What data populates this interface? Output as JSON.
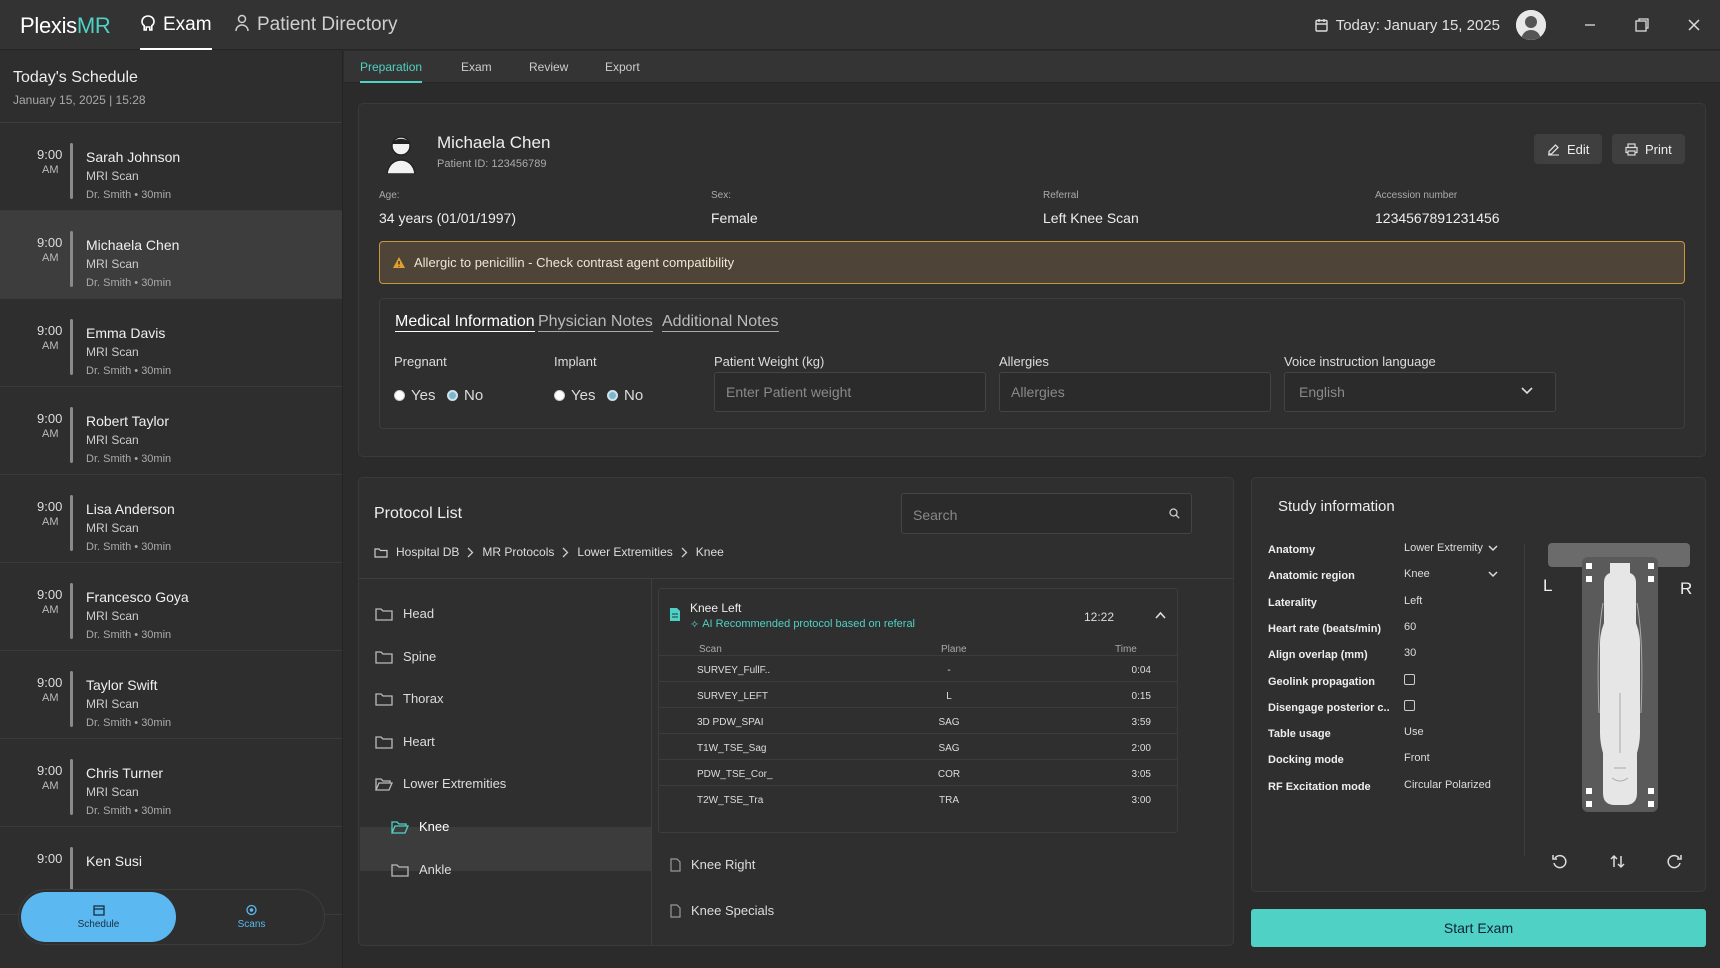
{
  "app": {
    "logo_a": "Plexis",
    "logo_b": "MR",
    "nav": [
      {
        "label": "Exam"
      },
      {
        "label": "Patient Directory"
      }
    ],
    "date": "Today: January 15, 2025"
  },
  "schedule": {
    "title": "Today's Schedule",
    "date": "January 15, 2025 | 15:28",
    "items": [
      {
        "time": "9:00",
        "ampm": "AM",
        "name": "Sarah Johnson",
        "type": "MRI Scan",
        "doctor": "Dr. Smith • 30min"
      },
      {
        "time": "9:00",
        "ampm": "AM",
        "name": "Michaela Chen",
        "type": "MRI Scan",
        "doctor": "Dr. Smith • 30min"
      },
      {
        "time": "9:00",
        "ampm": "AM",
        "name": "Emma Davis",
        "type": "MRI Scan",
        "doctor": "Dr. Smith • 30min"
      },
      {
        "time": "9:00",
        "ampm": "AM",
        "name": "Robert Taylor",
        "type": "MRI Scan",
        "doctor": "Dr. Smith • 30min"
      },
      {
        "time": "9:00",
        "ampm": "AM",
        "name": "Lisa Anderson",
        "type": "MRI Scan",
        "doctor": "Dr. Smith • 30min"
      },
      {
        "time": "9:00",
        "ampm": "AM",
        "name": "Francesco Goya",
        "type": "MRI Scan",
        "doctor": "Dr. Smith • 30min"
      },
      {
        "time": "9:00",
        "ampm": "AM",
        "name": "Taylor Swift",
        "type": "MRI Scan",
        "doctor": "Dr. Smith • 30min"
      },
      {
        "time": "9:00",
        "ampm": "AM",
        "name": "Chris Turner",
        "type": "MRI Scan",
        "doctor": "Dr. Smith • 30min"
      },
      {
        "time": "9:00",
        "ampm": "",
        "name": "Ken Susi",
        "type": "",
        "doctor": ""
      }
    ],
    "bottom_nav": {
      "schedule": "Schedule",
      "scans": "Scans"
    }
  },
  "subtabs": [
    "Preparation",
    "Exam",
    "Review",
    "Export"
  ],
  "patient": {
    "name": "Michaela Chen",
    "id": "Patient ID: 123456789",
    "edit": "Edit",
    "print": "Print",
    "fields": [
      {
        "label": "Age:",
        "value": "34 years (01/01/1997)"
      },
      {
        "label": "Sex:",
        "value": "Female"
      },
      {
        "label": "Referral",
        "value": "Left Knee Scan"
      },
      {
        "label": "Accession number",
        "value": "1234567891231456"
      }
    ],
    "alert": "Allergic to penicillin - Check contrast agent compatibility"
  },
  "medical": {
    "tabs": [
      "Medical Information",
      "Physician Notes",
      "Additional Notes"
    ],
    "pregnant": {
      "label": "Pregnant",
      "yes": "Yes",
      "no": "No"
    },
    "implant": {
      "label": "Implant",
      "yes": "Yes",
      "no": "No"
    },
    "weight": {
      "label": "Patient Weight (kg)",
      "placeholder": "Enter Patient weight"
    },
    "allergies": {
      "label": "Allergies",
      "placeholder": "Allergies"
    },
    "language": {
      "label": "Voice instruction language",
      "value": "English"
    }
  },
  "protocol": {
    "title": "Protocol List",
    "search_placeholder": "Search",
    "breadcrumb": [
      "Hospital DB",
      "MR Protocols",
      "Lower Extremities",
      "Knee"
    ],
    "folders": [
      "Head",
      "Spine",
      "Thorax",
      "Heart",
      "Lower Extremities",
      "Knee",
      "Ankle"
    ],
    "selected": {
      "name": "Knee Left",
      "ai": "AI Recommended protocol based on referal",
      "time": "12:22",
      "headers": {
        "scan": "Scan",
        "plane": "Plane",
        "time": "Time"
      },
      "rows": [
        {
          "scan": "SURVEY_FullF..",
          "plane": "-",
          "time": "0:04"
        },
        {
          "scan": "SURVEY_LEFT",
          "plane": "L",
          "time": "0:15"
        },
        {
          "scan": "3D PDW_SPAI",
          "plane": "SAG",
          "time": "3:59"
        },
        {
          "scan": "T1W_TSE_Sag",
          "plane": "SAG",
          "time": "2:00"
        },
        {
          "scan": "PDW_TSE_Cor_",
          "plane": "COR",
          "time": "3:05"
        },
        {
          "scan": "T2W_TSE_Tra",
          "plane": "TRA",
          "time": "3:00"
        }
      ]
    },
    "others": [
      "Knee Right",
      "Knee Specials"
    ]
  },
  "study": {
    "title": "Study information",
    "rows": [
      {
        "label": "Anatomy",
        "value": "Lower Extremity",
        "kind": "select"
      },
      {
        "label": "Anatomic region",
        "value": "Knee",
        "kind": "select"
      },
      {
        "label": "Laterality",
        "value": "Left",
        "kind": "text"
      },
      {
        "label": "Heart rate (beats/min)",
        "value": "60",
        "kind": "text"
      },
      {
        "label": "Align overlap (mm)",
        "value": "30",
        "kind": "text"
      },
      {
        "label": "Geolink propagation",
        "value": "",
        "kind": "check"
      },
      {
        "label": "Disengage posterior c..",
        "value": "",
        "kind": "check"
      },
      {
        "label": "Table usage",
        "value": "Use",
        "kind": "text"
      },
      {
        "label": "Docking mode",
        "value": "Front",
        "kind": "text"
      },
      {
        "label": "RF Excitation mode",
        "value": "Circular Polarized",
        "kind": "text"
      }
    ],
    "left_marker": "L",
    "right_marker": "R",
    "start": "Start Exam"
  },
  "colors": {
    "accent": "#4fd1c5",
    "alert_border": "#c7963a",
    "schedule_btn": "#5bb8f0"
  }
}
